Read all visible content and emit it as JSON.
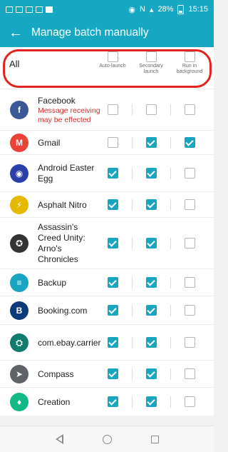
{
  "status_bar": {
    "battery": "28%",
    "time": "15:15"
  },
  "header": {
    "title": "Manage batch manually",
    "back_icon": "arrow-left-icon"
  },
  "all_row": {
    "label": "All",
    "columns": [
      {
        "key": "auto",
        "label": "Auto-launch",
        "checked": false
      },
      {
        "key": "secondary",
        "label": "Secondary launch",
        "checked": false
      },
      {
        "key": "background",
        "label": "Run in background",
        "checked": false
      }
    ]
  },
  "apps": [
    {
      "name": "Facebook",
      "note": "Message receiving may be effected",
      "icon": "facebook-icon",
      "auto": false,
      "secondary": false,
      "background": false,
      "color": "#3b5998"
    },
    {
      "name": "Gmail",
      "note": "",
      "icon": "gmail-icon",
      "auto": false,
      "secondary": true,
      "background": true,
      "color": "#ea4335"
    },
    {
      "name": "Android Easter Egg",
      "note": "",
      "icon": "android-easter-egg-icon",
      "auto": true,
      "secondary": true,
      "background": false,
      "color": "#2c3fa8"
    },
    {
      "name": "Asphalt Nitro",
      "note": "",
      "icon": "asphalt-nitro-icon",
      "auto": true,
      "secondary": true,
      "background": false,
      "color": "#e6b800"
    },
    {
      "name": "Assassin's Creed Unity: Arno's Chronicles",
      "note": "",
      "icon": "assassins-creed-icon",
      "auto": true,
      "secondary": true,
      "background": false,
      "color": "#333333"
    },
    {
      "name": "Backup",
      "note": "",
      "icon": "backup-icon",
      "auto": true,
      "secondary": true,
      "background": false,
      "color": "#18a5c1"
    },
    {
      "name": "Booking.com",
      "note": "",
      "icon": "booking-icon",
      "auto": true,
      "secondary": true,
      "background": false,
      "color": "#0b3b7a"
    },
    {
      "name": "com.ebay.carrier",
      "note": "",
      "icon": "android-robot-icon",
      "auto": true,
      "secondary": true,
      "background": false,
      "color": "#0f7d6d"
    },
    {
      "name": "Compass",
      "note": "",
      "icon": "compass-icon",
      "auto": true,
      "secondary": true,
      "background": false,
      "color": "#5f6368"
    },
    {
      "name": "Creation",
      "note": "",
      "icon": "creation-icon",
      "auto": true,
      "secondary": true,
      "background": false,
      "color": "#12b886"
    }
  ],
  "nav": {
    "back_icon": "nav-back-icon",
    "home_icon": "nav-home-icon",
    "recents_icon": "nav-recents-icon"
  }
}
